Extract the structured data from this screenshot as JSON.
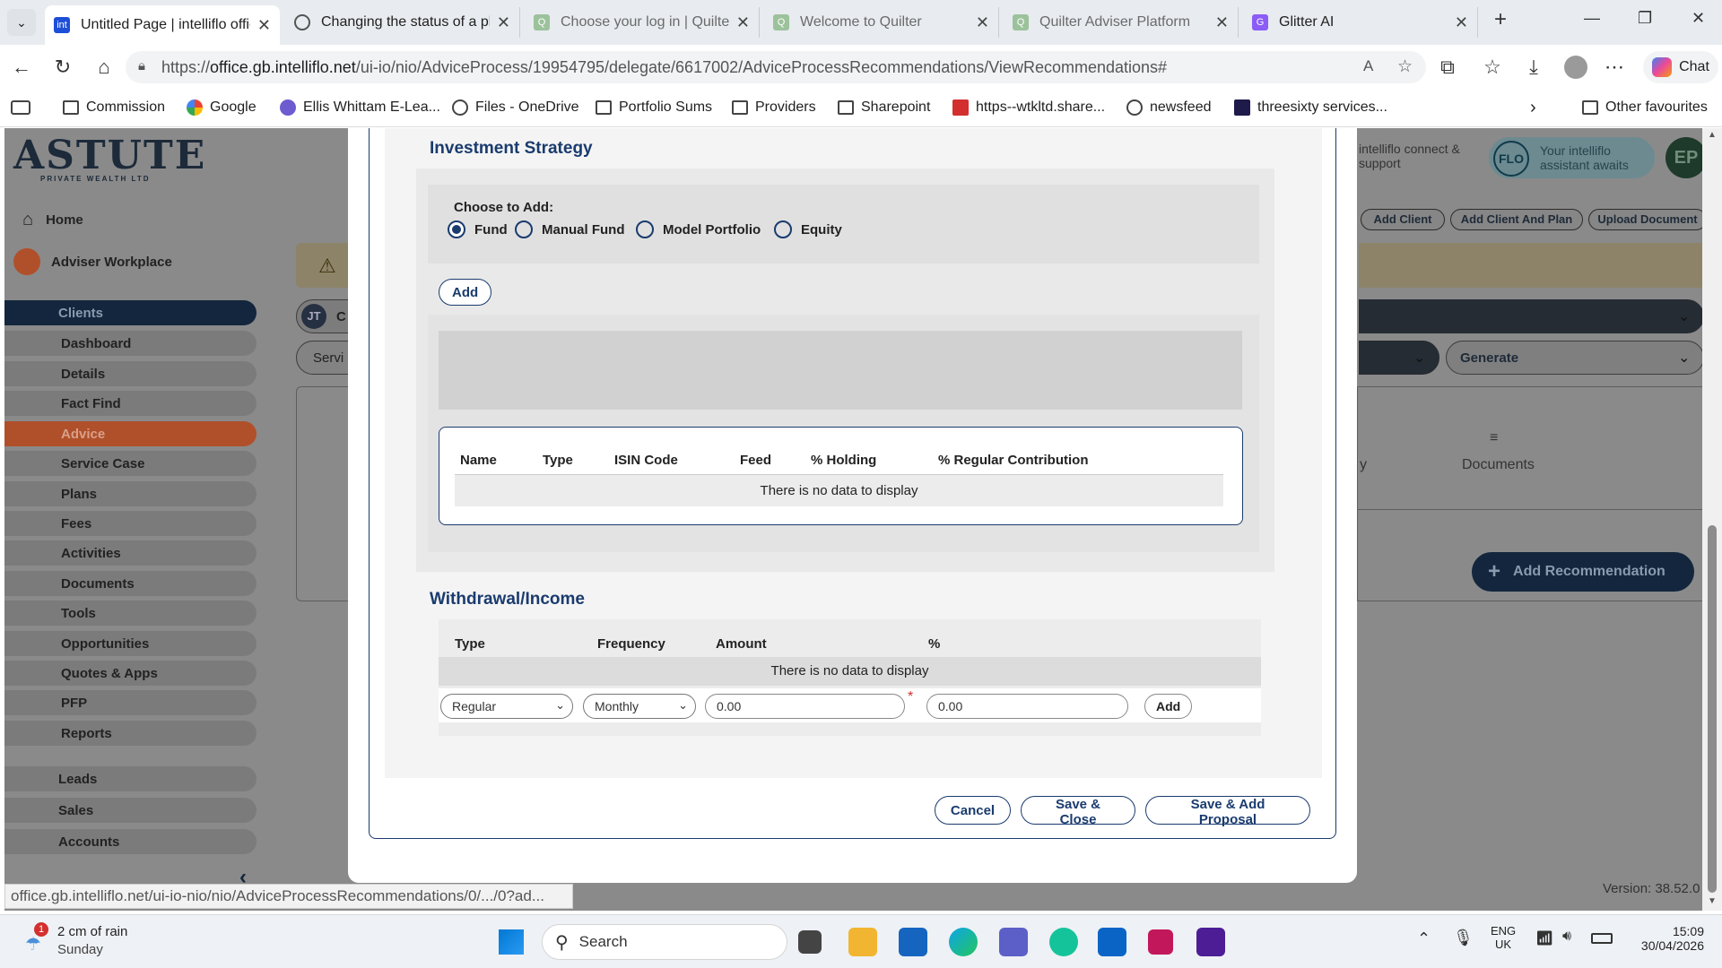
{
  "tabs": [
    {
      "title": "Untitled Page | intelliflo office",
      "active": true
    },
    {
      "title": "Changing the status of a plan"
    },
    {
      "title": "Choose your log in | Quilter"
    },
    {
      "title": "Welcome to Quilter"
    },
    {
      "title": "Quilter Adviser Platform"
    },
    {
      "title": "Glitter AI"
    }
  ],
  "address": {
    "prefix": "https://",
    "domain": "office.gb.intelliflo.net",
    "path": "/ui-io/nio/AdviceProcess/19954795/delegate/6617002/AdviceProcessRecommendations/ViewRecommendations#"
  },
  "chat_label": "Chat",
  "bookmarks": [
    "Commission",
    "Google",
    "Ellis Whittam E-Lea...",
    "Files - OneDrive",
    "Portfolio Sums",
    "Providers",
    "Sharepoint",
    "https--wtkltd.share...",
    "newsfeed",
    "threesixty services...",
    "Other favourites"
  ],
  "sidebar": {
    "logo": "ASTUTE",
    "logo_sub": "PRIVATE WEALTH LTD",
    "home": "Home",
    "workplace": "Adviser Workplace",
    "items": [
      "Clients",
      "Dashboard",
      "Details",
      "Fact Find",
      "Advice",
      "Service Case",
      "Plans",
      "Fees",
      "Activities",
      "Documents",
      "Tools",
      "Opportunities",
      "Quotes & Apps",
      "PFP",
      "Reports"
    ],
    "bottom": [
      "Leads",
      "Sales",
      "Accounts"
    ]
  },
  "header": {
    "connect": "intelliflo connect & support",
    "flo": "Your intelliflo assistant awaits",
    "flo_badge": "FLO",
    "avatar": "EP",
    "buttons": [
      "Add Client",
      "Add Client And Plan",
      "Upload Document"
    ],
    "client_initials": "JT",
    "client_letter": "C",
    "servi": "Servi",
    "generate": "Generate",
    "documents": "Documents",
    "add_recommendation": "Add Recommendation",
    "version": "Version: 38.52.0",
    "partial_y": "y"
  },
  "modal": {
    "investment_title": "Investment Strategy",
    "choose_label": "Choose to Add:",
    "radios": [
      "Fund",
      "Manual Fund",
      "Model Portfolio",
      "Equity"
    ],
    "selected_radio": "Fund",
    "add_label": "Add",
    "fund_columns": [
      "Name",
      "Type",
      "ISIN Code",
      "Feed",
      "% Holding",
      "% Regular Contribution"
    ],
    "no_data": "There is no data to display",
    "withdrawal_title": "Withdrawal/Income",
    "withdrawal_columns": [
      "Type",
      "Frequency",
      "Amount",
      "%"
    ],
    "type_value": "Regular",
    "frequency_value": "Monthly",
    "amount_value": "0.00",
    "percent_value": "0.00",
    "row_add": "Add",
    "cancel": "Cancel",
    "save_close": "Save & Close",
    "save_add_proposal": "Save & Add Proposal"
  },
  "status_url": "office.gb.intelliflo.net/ui-io-nio/nio/AdviceProcessRecommendations/0/.../0?ad...",
  "taskbar": {
    "weather": "2 cm of rain",
    "day": "Sunday",
    "weather_badge": "1",
    "search": "Search",
    "lang1": "ENG",
    "lang2": "UK",
    "time": "15:09",
    "date": "30/04/2026"
  }
}
